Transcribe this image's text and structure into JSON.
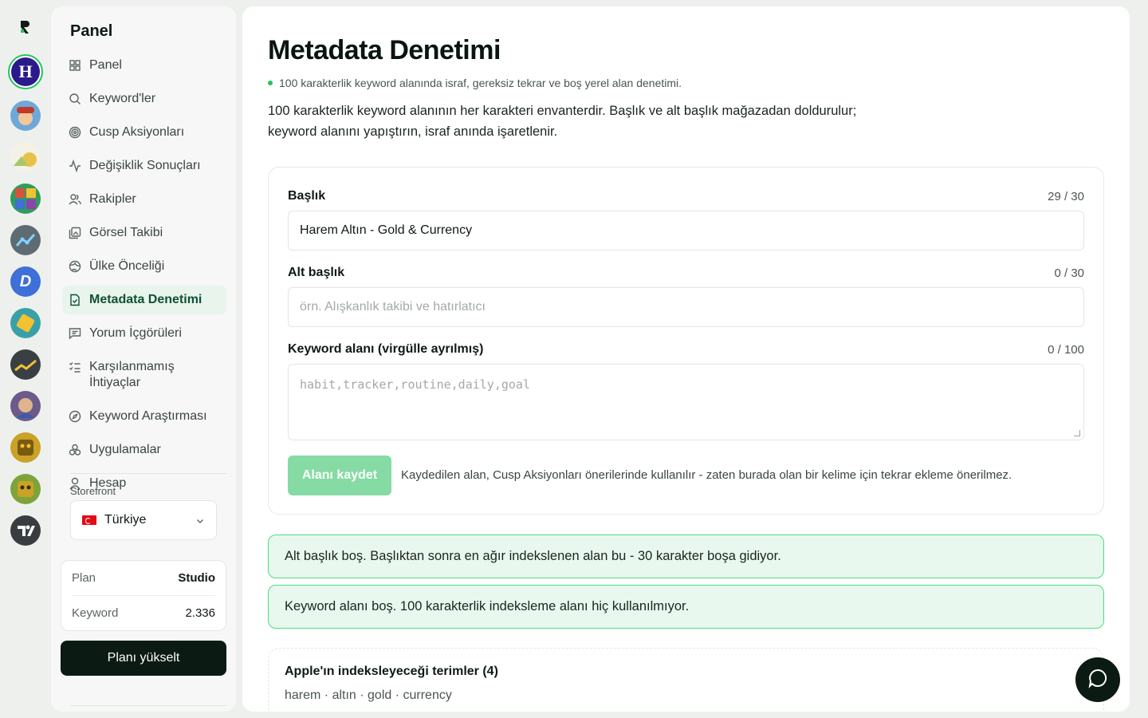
{
  "brand": {
    "logo": "R"
  },
  "apps": [
    {
      "name": "harem-altin",
      "letter": "H",
      "color": "#2b1a8c",
      "active": true
    },
    {
      "name": "app-2",
      "letter": "",
      "color": "#6ea8d8"
    },
    {
      "name": "app-3",
      "letter": "",
      "color": "#e8c14a"
    },
    {
      "name": "app-4",
      "letter": "",
      "color": "#d9503f"
    },
    {
      "name": "app-5",
      "letter": "",
      "color": "#5f6b73"
    },
    {
      "name": "app-6",
      "letter": "D",
      "color": "#3f6fd8"
    },
    {
      "name": "app-7",
      "letter": "",
      "color": "#3aa0a8"
    },
    {
      "name": "app-8",
      "letter": "",
      "color": "#3a3f44"
    },
    {
      "name": "app-9",
      "letter": "",
      "color": "#6b5b8a"
    },
    {
      "name": "app-10",
      "letter": "",
      "color": "#c9a227"
    },
    {
      "name": "app-11",
      "letter": "",
      "color": "#7ea33a"
    },
    {
      "name": "app-12",
      "letter": "",
      "color": "#3a3d40"
    }
  ],
  "sidebar": {
    "title": "Panel",
    "items": [
      {
        "label": "Panel",
        "icon": "grid-icon"
      },
      {
        "label": "Keyword'ler",
        "icon": "search-icon"
      },
      {
        "label": "Cusp Aksiyonları",
        "icon": "target-icon"
      },
      {
        "label": "Değişiklik Sonuçları",
        "icon": "activity-icon"
      },
      {
        "label": "Rakipler",
        "icon": "users-icon"
      },
      {
        "label": "Görsel Takibi",
        "icon": "images-icon"
      },
      {
        "label": "Ülke Önceliği",
        "icon": "globe-icon"
      },
      {
        "label": "Metadata Denetimi",
        "icon": "file-check-icon",
        "active": true
      },
      {
        "label": "Yorum İçgörüleri",
        "icon": "message-icon"
      },
      {
        "label": "Karşılanmamış İhtiyaçlar",
        "icon": "checklist-icon"
      },
      {
        "label": "Keyword Araştırması",
        "icon": "compass-icon"
      },
      {
        "label": "Uygulamalar",
        "icon": "apps-icon"
      },
      {
        "label": "Hesap",
        "icon": "user-icon"
      }
    ],
    "storefront_label": "Storefront",
    "storefront_value": "Türkiye",
    "plan": {
      "plan_label": "Plan",
      "plan_value": "Studio",
      "keyword_label": "Keyword",
      "keyword_value": "2.336"
    },
    "upgrade_label": "Planı yükselt"
  },
  "main": {
    "title": "Metadata Denetimi",
    "subtitle": "100 karakterlik keyword alanında israf, gereksiz tekrar ve boş yerel alan denetimi.",
    "description": "100 karakterlik keyword alanının her karakteri envanterdir. Başlık ve alt başlık mağazadan doldurulur; keyword alanını yapıştırın, israf anında işaretlenir.",
    "form": {
      "title_label": "Başlık",
      "title_counter": "29 / 30",
      "title_value": "Harem Altın - Gold & Currency",
      "subtitle_label": "Alt başlık",
      "subtitle_counter": "0 / 30",
      "subtitle_placeholder": "örn. Alışkanlık takibi ve hatırlatıcı",
      "keyword_label": "Keyword alanı (virgülle ayrılmış)",
      "keyword_counter": "0 / 100",
      "keyword_placeholder": "habit,tracker,routine,daily,goal",
      "save_label": "Alanı kaydet",
      "save_note": "Kaydedilen alan, Cusp Aksiyonları önerilerinde kullanılır - zaten burada olan bir kelime için tekrar ekleme önerilmez."
    },
    "alerts": [
      "Alt başlık boş. Başlıktan sonra en ağır indekslenen alan bu - 30 karakter boşa gidiyor.",
      "Keyword alanı boş. 100 karakterlik indeksleme alanı hiç kullanılmıyor."
    ],
    "terms": {
      "title": "Apple'ın indeksleyeceği terimler (4)",
      "list": "harem · altın · gold · currency"
    }
  },
  "colors": {
    "accent": "#22c55e",
    "active_bg": "#e8f4ec",
    "alert_bg": "#e9f8ee",
    "button_dark": "#0b1a12",
    "save_button": "#86dba5"
  }
}
